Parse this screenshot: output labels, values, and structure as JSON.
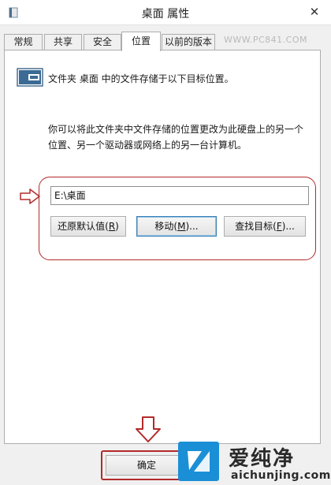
{
  "window": {
    "title": "桌面 属性",
    "close_glyph": "✕"
  },
  "tabs": [
    {
      "label": "常规",
      "active": false
    },
    {
      "label": "共享",
      "active": false
    },
    {
      "label": "安全",
      "active": false
    },
    {
      "label": "位置",
      "active": true
    },
    {
      "label": "以前的版本",
      "active": false
    }
  ],
  "watermark_text": "WWW.PC841.COM",
  "location": {
    "intro": "文件夹 桌面 中的文件存储于以下目标位置。",
    "description_line1": "你可以将此文件夹中文件存储的位置更改为此硬盘上的另一个",
    "description_line2": "位置、另一个驱动器或网络上的另一台计算机。",
    "path_value": "E:\\桌面"
  },
  "buttons": {
    "restore_default": {
      "text": "还原默认值(",
      "key": "R",
      "tail": ")"
    },
    "move": {
      "text": "移动(",
      "key": "M",
      "tail": ")..."
    },
    "find_target": {
      "text": "查找目标(",
      "key": "F",
      "tail": ")..."
    },
    "ok": "确定"
  },
  "logo": {
    "name": "爱纯净",
    "url": "aichunjing.com"
  },
  "colors": {
    "annotation_red": "#b22a2a",
    "logo_blue": "#1a8fd6"
  },
  "icons": {
    "title": "folder-properties-icon",
    "folder": "desktop-folder-icon",
    "annotation_side": "right-arrow-icon",
    "annotation_down": "down-arrow-icon"
  }
}
